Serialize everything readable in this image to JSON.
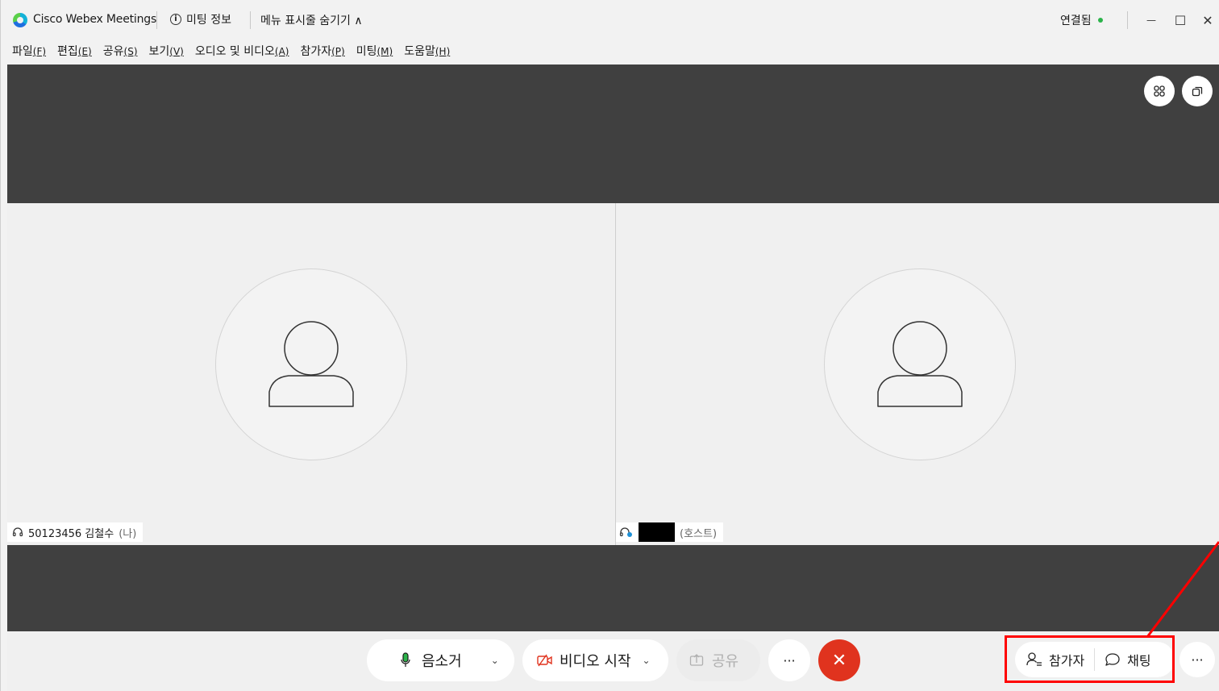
{
  "titlebar": {
    "app_title": "Cisco Webex Meetings",
    "meeting_info": "미팅 정보",
    "hide_menu": "메뉴 표시줄 숨기기 ∧",
    "status": "연결됨",
    "status_color": "#2bb34a",
    "minimize": "—",
    "maximize": "☐",
    "close": "✕"
  },
  "menubar": {
    "items": [
      {
        "label": "파일",
        "key": "(F)"
      },
      {
        "label": "편집",
        "key": "(E)"
      },
      {
        "label": "공유",
        "key": "(S)"
      },
      {
        "label": "보기",
        "key": "(V)"
      },
      {
        "label": "오디오 및 비디오",
        "key": "(A)"
      },
      {
        "label": "참가자",
        "key": "(P)"
      },
      {
        "label": "미팅",
        "key": "(M)"
      },
      {
        "label": "도움말",
        "key": "(H)"
      }
    ]
  },
  "participants": [
    {
      "name": "50123456 김철수",
      "tag": "(나)"
    },
    {
      "name": "",
      "tag": "(호스트)"
    }
  ],
  "controls": {
    "mute": "음소거",
    "video": "비디오 시작",
    "share": "공유",
    "more": "···",
    "end": "✕",
    "participants": "참가자",
    "chat": "채팅",
    "more_right": "···"
  },
  "colors": {
    "stage": "#404040",
    "end_button": "#e0331e",
    "highlight": "#ff0000"
  }
}
